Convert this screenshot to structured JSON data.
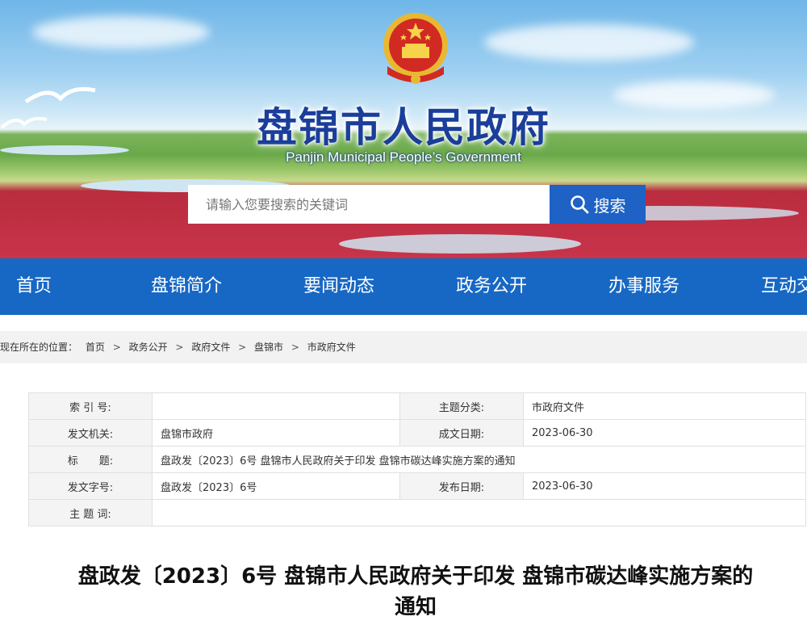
{
  "header": {
    "site_title": "盘锦市人民政府",
    "site_subtitle": "Panjin Municipal People’s Government",
    "search_placeholder": "请输入您要搜索的关键词",
    "search_button": "搜索"
  },
  "nav": {
    "items": [
      "首页",
      "盘锦简介",
      "要闻动态",
      "政务公开",
      "办事服务",
      "互动交流"
    ]
  },
  "breadcrumb": {
    "prefix": "现在所在的位置：",
    "items": [
      "首页",
      "政务公开",
      "政府文件",
      "盘锦市",
      "市政府文件"
    ],
    "separator": ">"
  },
  "info": {
    "index_label": "索 引 号:",
    "index_value": "",
    "category_label": "主题分类:",
    "category_value": "市政府文件",
    "issuer_label": "发文机关:",
    "issuer_value": "盘锦市政府",
    "created_label": "成文日期:",
    "created_value": "2023-06-30",
    "title_label": "标　　题:",
    "title_value": "盘政发〔2023〕6号 盘锦市人民政府关于印发 盘锦市碳达峰实施方案的通知",
    "docno_label": "发文字号:",
    "docno_value": "盘政发〔2023〕6号",
    "published_label": "发布日期:",
    "published_value": "2023-06-30",
    "keywords_label": "主 题 词:",
    "keywords_value": ""
  },
  "document": {
    "title_line1": "盘政发〔2023〕6号 盘锦市人民政府关于印发 盘锦市碳达峰实施方案的",
    "title_line2": "通知"
  },
  "colors": {
    "nav_bg": "#1768c4",
    "title_blue": "#1a3e9a",
    "search_button_bg": "#1d62c4"
  }
}
